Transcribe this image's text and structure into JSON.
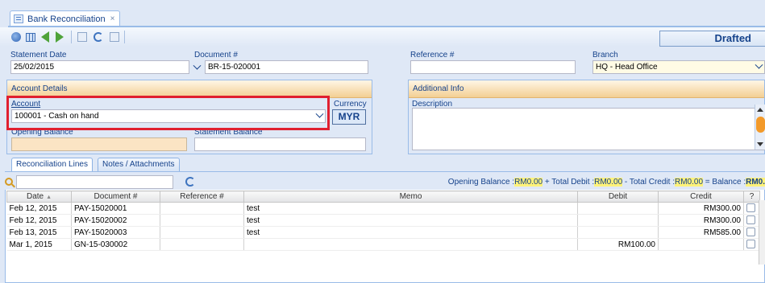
{
  "tab": {
    "title": "Bank Reconciliation",
    "close": "×"
  },
  "status": "Drafted",
  "header": {
    "statement_date_label": "Statement Date",
    "statement_date": "25/02/2015",
    "document_label": "Document #",
    "document": "BR-15-020001",
    "reference_label": "Reference #",
    "reference": "",
    "branch_label": "Branch",
    "branch": "HQ - Head Office"
  },
  "account_details": {
    "title": "Account Details",
    "account_label": "Account",
    "account": "100001 - Cash on hand",
    "currency_label": "Currency",
    "currency": "MYR",
    "opening_balance_label": "Opening Balance",
    "statement_balance_label": "Statement Balance"
  },
  "additional_info": {
    "title": "Additional Info",
    "description_label": "Description"
  },
  "lower_tabs": [
    "Reconciliation Lines",
    "Notes / Attachments"
  ],
  "summary": {
    "opening_label": "Opening Balance :",
    "opening": "RM0.00",
    "debit_label": " + Total Debit :",
    "debit": "RM0.00",
    "credit_label": " - Total Credit :",
    "credit": "RM0.00",
    "balance_label": " = Balance :",
    "balance": "RM0."
  },
  "grid": {
    "columns": [
      "Date",
      "Document #",
      "Reference #",
      "Memo",
      "Debit",
      "Credit",
      "?"
    ],
    "rows": [
      {
        "date": "Feb 12, 2015",
        "document": "PAY-15020001",
        "reference": "",
        "memo": "test",
        "debit": "",
        "credit": "RM300.00"
      },
      {
        "date": "Feb 12, 2015",
        "document": "PAY-15020002",
        "reference": "",
        "memo": "test",
        "debit": "",
        "credit": "RM300.00"
      },
      {
        "date": "Feb 13, 2015",
        "document": "PAY-15020003",
        "reference": "",
        "memo": "test",
        "debit": "",
        "credit": "RM585.00"
      },
      {
        "date": "Mar 1, 2015",
        "document": "GN-15-030002",
        "reference": "",
        "memo": "",
        "debit": "RM100.00",
        "credit": ""
      }
    ]
  },
  "colors": {
    "highlight": "#e02030",
    "accent": "#15428b",
    "readonly": "#fbe4c4"
  }
}
